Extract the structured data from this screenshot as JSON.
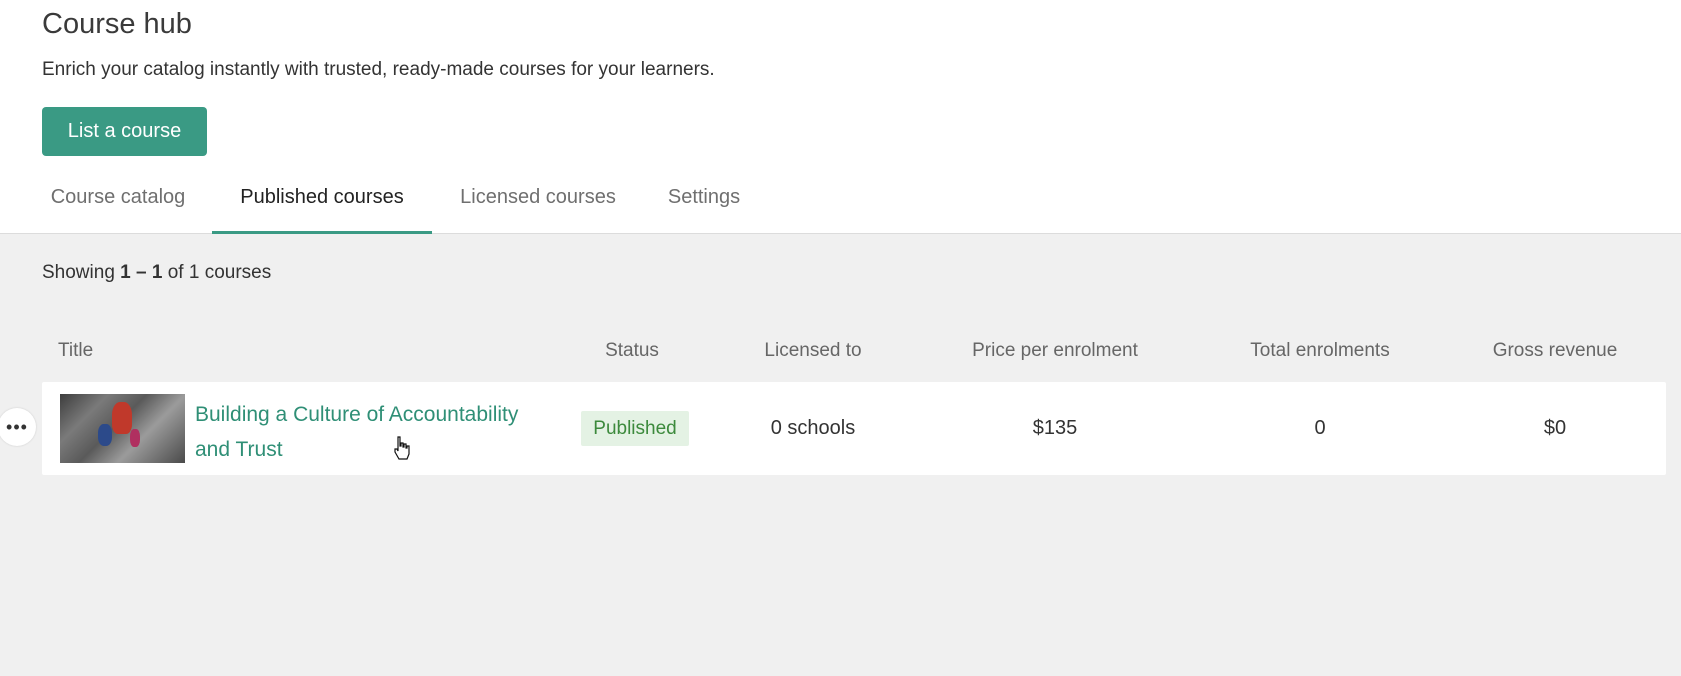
{
  "header": {
    "title": "Course hub",
    "subtitle": "Enrich your catalog instantly with trusted, ready-made courses for your learners.",
    "primary_button": "List a course"
  },
  "tabs": [
    {
      "label": "Course catalog",
      "active": false
    },
    {
      "label": "Published courses",
      "active": true
    },
    {
      "label": "Licensed courses",
      "active": false
    },
    {
      "label": "Settings",
      "active": false
    }
  ],
  "results": {
    "prefix": "Showing",
    "range": "1 – 1",
    "suffix": "of 1 courses"
  },
  "table": {
    "columns": [
      "Title",
      "Status",
      "Licensed to",
      "Price per enrolment",
      "Total enrolments",
      "Gross revenue"
    ],
    "rows": [
      {
        "title": "Building a Culture of Accountability and Trust",
        "status": "Published",
        "licensed_to": "0 schools",
        "price": "$135",
        "total_enrolments": "0",
        "gross_revenue": "$0"
      }
    ],
    "row_menu_icon": "more-horizontal-icon"
  },
  "colors": {
    "accent": "#3a9a84",
    "link": "#2f8f76",
    "status_bg": "#e4f2e4",
    "status_text": "#3c8a3c"
  }
}
